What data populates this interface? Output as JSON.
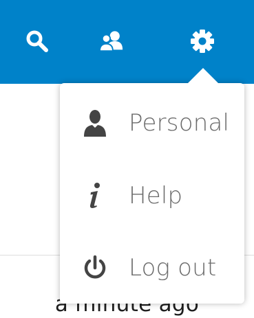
{
  "header": {
    "background_color": "#0082c9",
    "icons": [
      {
        "name": "search-icon"
      },
      {
        "name": "contacts-icon"
      },
      {
        "name": "settings-gear-icon"
      }
    ]
  },
  "menu": {
    "items": [
      {
        "label": "Personal",
        "icon": "user-icon"
      },
      {
        "label": "Help",
        "icon": "info-icon"
      },
      {
        "label": "Log out",
        "icon": "power-icon"
      }
    ]
  },
  "background": {
    "activity_text": "a minute ago"
  }
}
